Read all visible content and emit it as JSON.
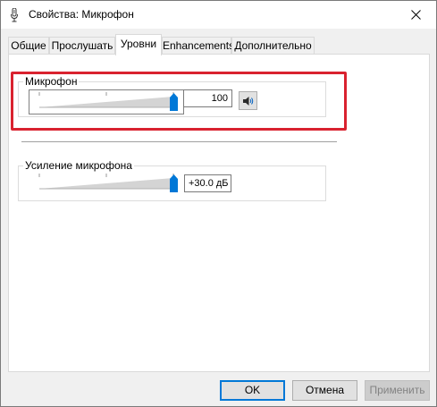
{
  "window": {
    "title": "Свойства: Микрофон"
  },
  "tabs": [
    {
      "label": "Общие",
      "active": false
    },
    {
      "label": "Прослушать",
      "active": false
    },
    {
      "label": "Уровни",
      "active": true
    },
    {
      "label": "Enhancements",
      "active": false
    },
    {
      "label": "Дополнительно",
      "active": false
    }
  ],
  "levels": {
    "microphone": {
      "label": "Микрофон",
      "value": "100",
      "level_fraction": 1.0,
      "mute_icon": "speaker-icon"
    },
    "boost": {
      "label": "Усиление микрофона",
      "value": "+30.0 дБ",
      "level_fraction": 1.0
    }
  },
  "buttons": {
    "ok": "OK",
    "cancel": "Отмена",
    "apply": "Применить"
  },
  "colors": {
    "highlight": "#d9222f",
    "thumb": "#0078d7",
    "default_button_border": "#0078d7"
  }
}
